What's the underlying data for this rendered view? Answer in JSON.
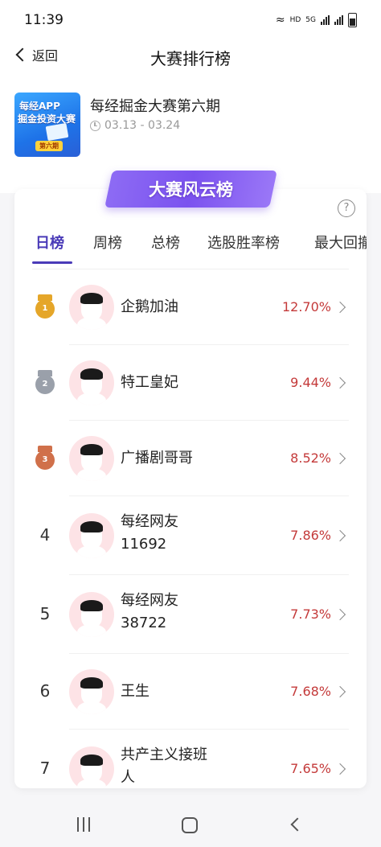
{
  "status_bar": {
    "time": "11:39",
    "network": "HD",
    "signal": "5G"
  },
  "nav": {
    "back_label": "返回",
    "title": "大赛排行榜"
  },
  "contest": {
    "thumb_line1": "每经APP",
    "thumb_line2": "掘金投资大赛",
    "thumb_badge": "第六期",
    "name": "每经掘金大赛第六期",
    "date_range": "03.13 - 03.24"
  },
  "board": {
    "title": "大赛风云榜",
    "help": "?",
    "tabs": [
      {
        "label": "日榜"
      },
      {
        "label": "周榜"
      },
      {
        "label": "总榜"
      },
      {
        "label": "选股胜率榜"
      },
      {
        "label": "最大回撤"
      }
    ],
    "rows": [
      {
        "rank": "1",
        "medal": "gold",
        "name": "企鹅加油",
        "yield": "12.70%"
      },
      {
        "rank": "2",
        "medal": "silver",
        "name": "特工皇妃",
        "yield": "9.44%"
      },
      {
        "rank": "3",
        "medal": "bronze",
        "name": "广播剧哥哥",
        "yield": "8.52%"
      },
      {
        "rank": "4",
        "name_line1": "每经网友",
        "name_line2": "11692",
        "yield": "7.86%"
      },
      {
        "rank": "5",
        "name_line1": "每经网友",
        "name_line2": "38722",
        "yield": "7.73%"
      },
      {
        "rank": "6",
        "name": "王生",
        "yield": "7.68%"
      },
      {
        "rank": "7",
        "name_line1": "共产主义接班",
        "name_line2": "人",
        "yield": "7.65%"
      }
    ]
  },
  "colors": {
    "accent": "#4a3bb8",
    "yield_red": "#c43a3a",
    "ribbon_purple": "#7b52ef",
    "gold": "#e5a629",
    "silver": "#9aa0aa",
    "bronze": "#d0704a"
  }
}
